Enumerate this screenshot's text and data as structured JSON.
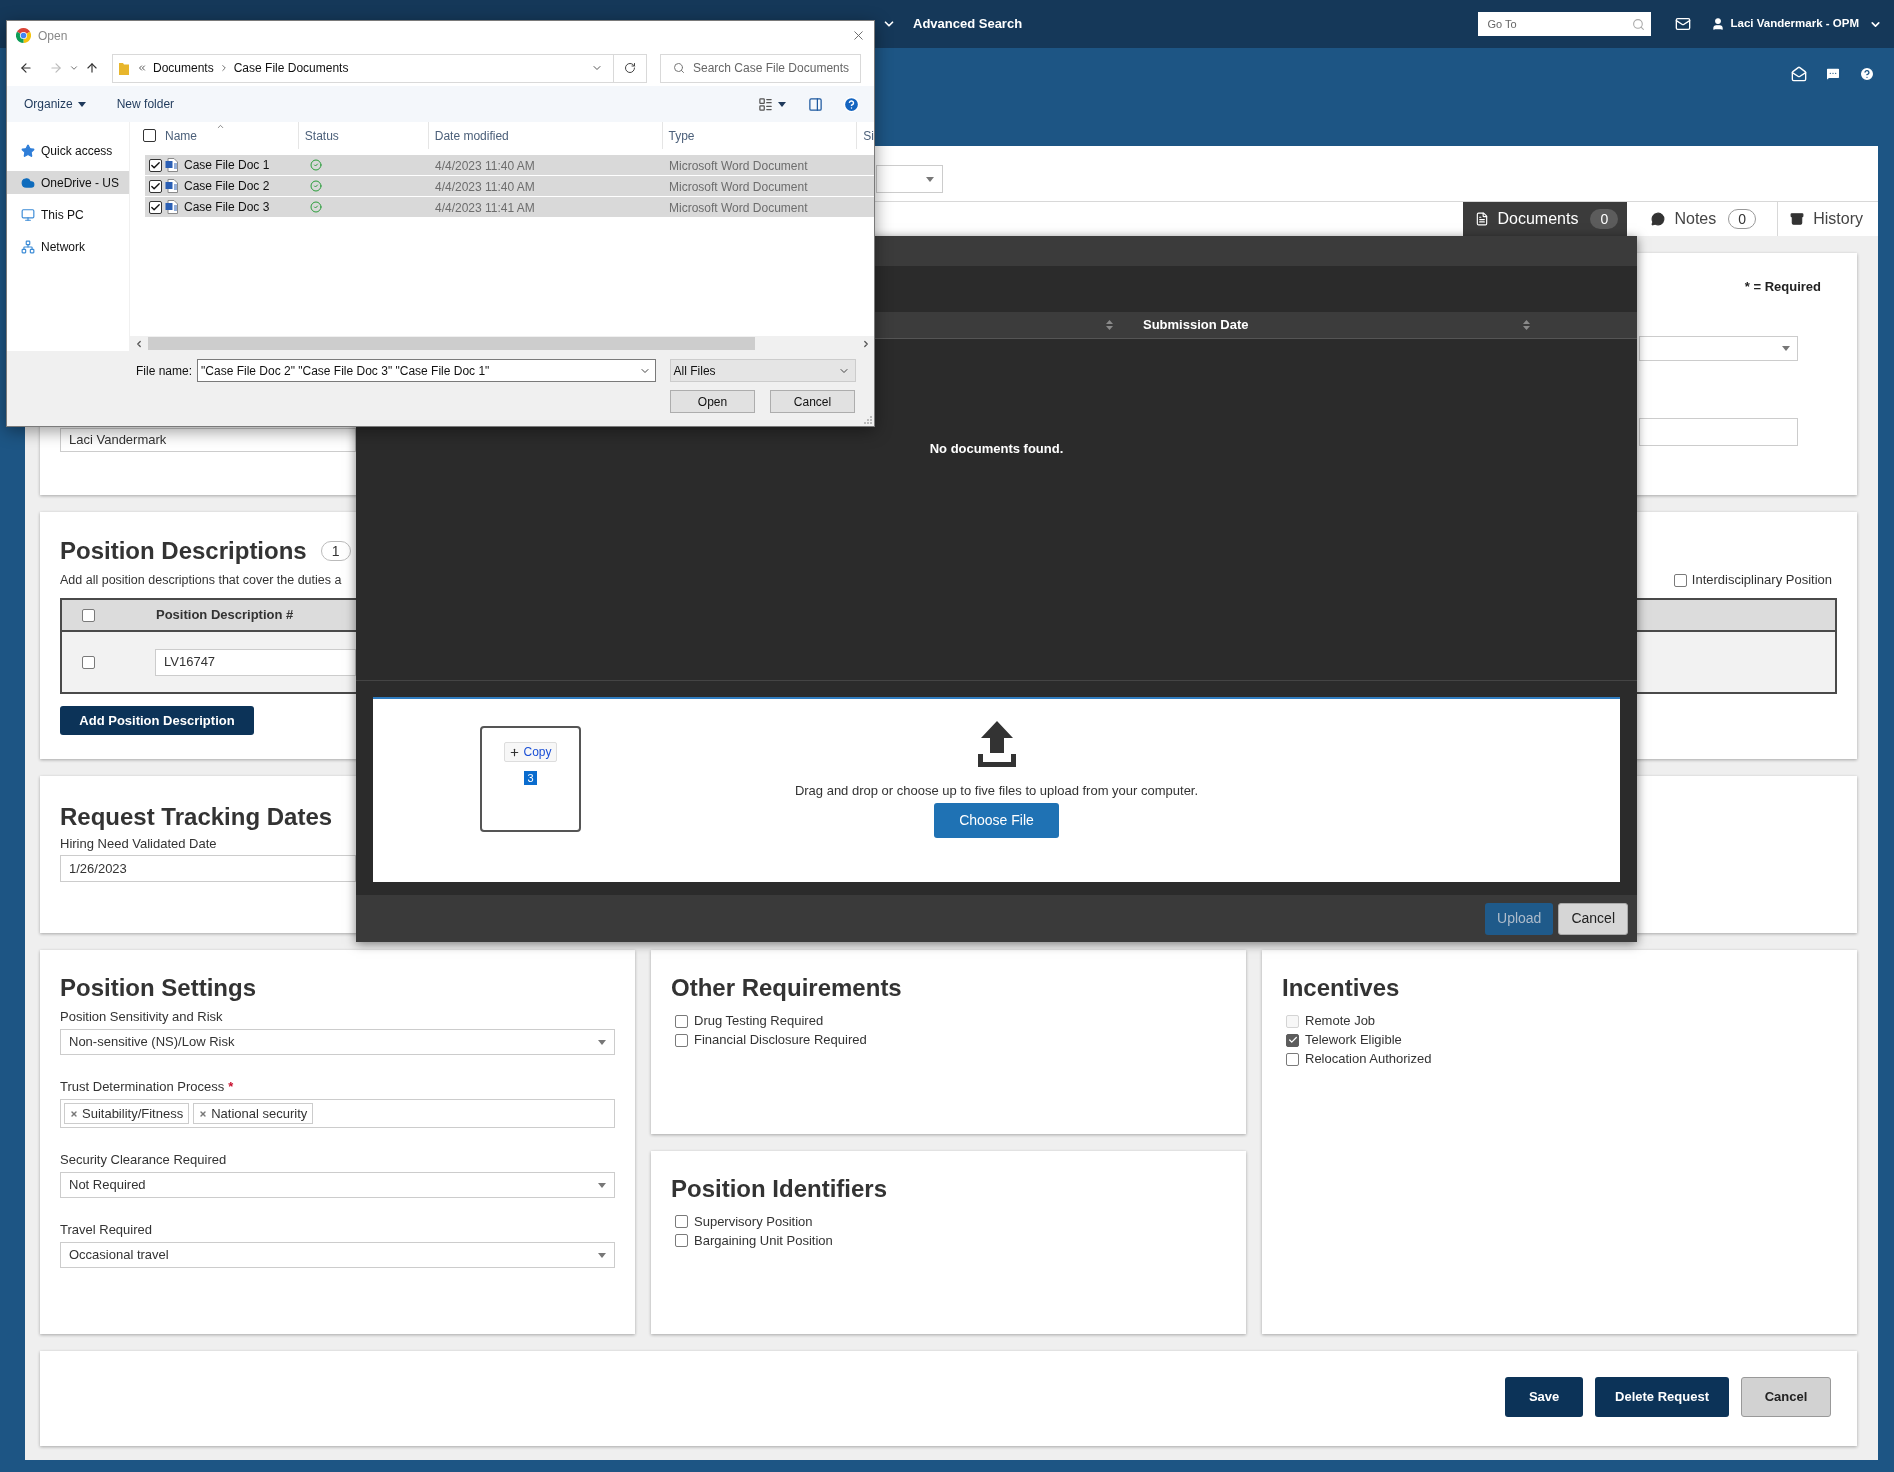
{
  "nav_bar": {
    "link": "Advanced Search",
    "search": {
      "placeholder": "Go To"
    },
    "user": "Laci Vandermark - OPM"
  },
  "tabs": [
    {
      "label": "Documents",
      "count": "0",
      "selected": true
    },
    {
      "label": "Notes",
      "count": "0",
      "selected": false
    },
    {
      "label": "History",
      "selected": false
    }
  ],
  "request_card": {
    "required_note": "* = Required",
    "name_value": "Laci Vandermark"
  },
  "position_descriptions": {
    "title": "Position Descriptions",
    "count": "1",
    "description": "Add all position descriptions that cover the duties a",
    "interdisciplinary": {
      "label": "Interdisciplinary Position",
      "checked": false
    },
    "table": {
      "all_checked": false,
      "columns": [
        "Position Description #"
      ],
      "rows": [
        {
          "checked": false,
          "value": "LV16747"
        }
      ]
    },
    "add_button": "Add Position Description"
  },
  "tracking_dates": {
    "title": "Request Tracking Dates",
    "fields": [
      {
        "label": "Hiring Need Validated Date",
        "value": "1/26/2023"
      }
    ]
  },
  "position_settings": {
    "title": "Position Settings",
    "fields": [
      {
        "kind": "select",
        "label": "Position Sensitivity and Risk",
        "value": "Non-sensitive (NS)/Low Risk"
      },
      {
        "kind": "tags",
        "label": "Trust Determination Process",
        "required_mark": "*",
        "tags": [
          "Suitability/Fitness",
          "National security"
        ]
      },
      {
        "kind": "select",
        "label": "Security Clearance Required",
        "value": "Not Required"
      },
      {
        "kind": "select",
        "label": "Travel Required",
        "value": "Occasional travel"
      }
    ]
  },
  "other_requirements": {
    "title": "Other Requirements",
    "options": [
      {
        "label": "Drug Testing Required",
        "checked": false
      },
      {
        "label": "Financial Disclosure Required",
        "checked": false
      }
    ]
  },
  "position_identifiers": {
    "title": "Position Identifiers",
    "options": [
      {
        "label": "Supervisory Position",
        "checked": false
      },
      {
        "label": "Bargaining Unit Position",
        "checked": false
      }
    ]
  },
  "incentives": {
    "title": "Incentives",
    "options": [
      {
        "label": "Remote Job",
        "checked": false,
        "disabled": true
      },
      {
        "label": "Telework Eligible",
        "checked": true,
        "disabled": false
      },
      {
        "label": "Relocation Authorized",
        "checked": false,
        "disabled": false
      }
    ]
  },
  "form_buttons": [
    {
      "label": "Save",
      "kind": "primary"
    },
    {
      "label": "Delete Request",
      "kind": "primary"
    },
    {
      "label": "Cancel",
      "kind": "secondary"
    }
  ],
  "documents_modal": {
    "columns": [
      "Submission Date"
    ],
    "empty_message": "No documents found.",
    "drop_zone": {
      "drag_action": "Copy",
      "drag_count": "3",
      "instructions": "Drag and drop or choose up to five files to upload from your computer.",
      "choose_button": "Choose File"
    },
    "buttons": [
      {
        "label": "Upload",
        "kind": "primary",
        "disabled": true
      },
      {
        "label": "Cancel",
        "kind": "secondary",
        "disabled": false
      }
    ]
  },
  "file_dialog": {
    "title": "Open",
    "path": [
      "Documents",
      "Case File Documents"
    ],
    "search": {
      "placeholder": "Search Case File Documents"
    },
    "toolbar": [
      {
        "label": "Organize",
        "kind": "menu"
      },
      {
        "label": "New folder",
        "kind": "button"
      }
    ],
    "nav": [
      {
        "label": "Quick access",
        "selected": false
      },
      {
        "label": "OneDrive - US",
        "selected": true
      },
      {
        "label": "This PC",
        "selected": false
      },
      {
        "label": "Network",
        "selected": false
      }
    ],
    "columns": [
      "Name",
      "Status",
      "Date modified",
      "Type",
      "Si"
    ],
    "all_checked": false,
    "files": [
      {
        "name": "Case File Doc 1",
        "checked": true,
        "selected": true,
        "date": "4/4/2023 11:40 AM",
        "type": "Microsoft Word Document"
      },
      {
        "name": "Case File Doc 2",
        "checked": true,
        "selected": true,
        "date": "4/4/2023 11:40 AM",
        "type": "Microsoft Word Document"
      },
      {
        "name": "Case File Doc 3",
        "checked": true,
        "selected": true,
        "date": "4/4/2023 11:41 AM",
        "type": "Microsoft Word Document"
      }
    ],
    "file_name_label": "File name:",
    "file_name": "\"Case File Doc 2\" \"Case File Doc 3\" \"Case File Doc 1\"",
    "file_type": "All Files",
    "buttons": [
      "Open",
      "Cancel"
    ]
  }
}
